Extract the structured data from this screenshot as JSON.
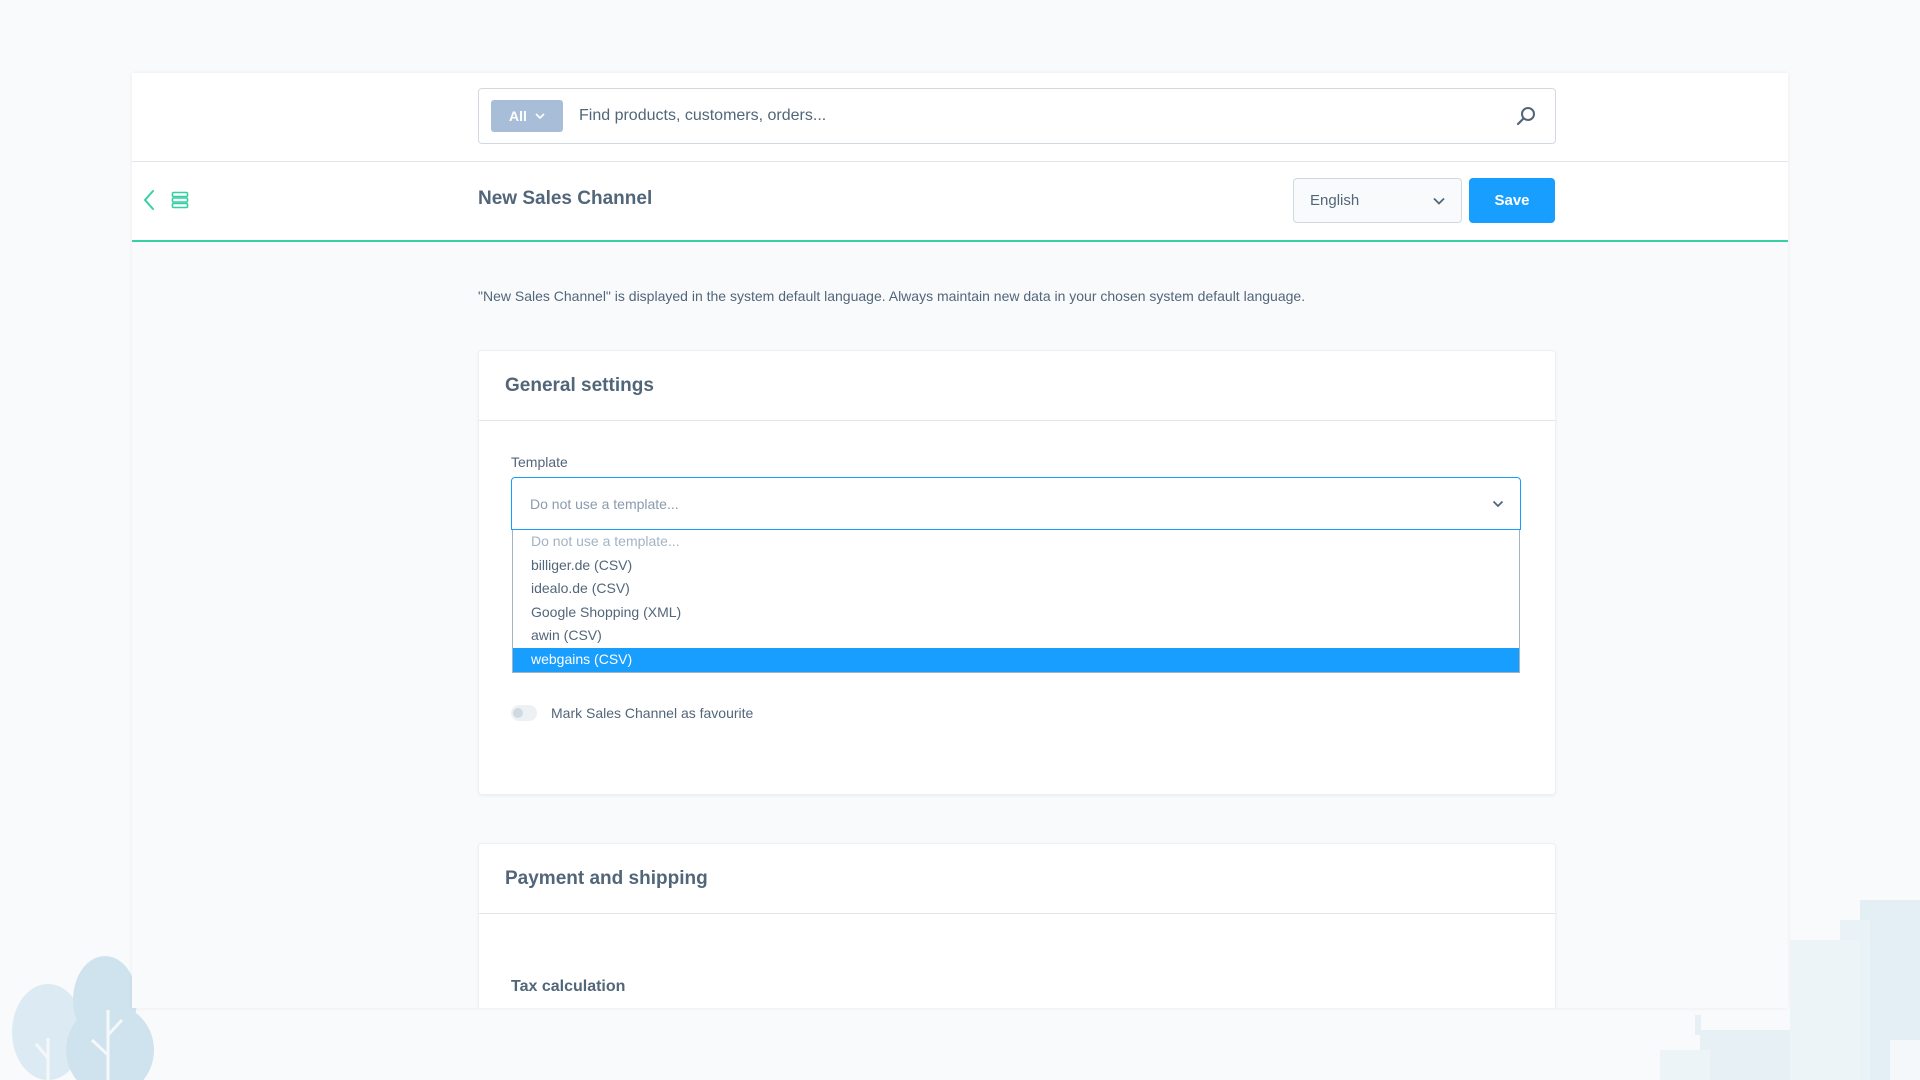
{
  "search": {
    "type_label": "All",
    "placeholder": "Find products, customers, orders..."
  },
  "smartbar": {
    "title": "New Sales Channel",
    "language": "English",
    "save_label": "Save"
  },
  "info_text": "\"New Sales Channel\" is displayed in the system default language. Always maintain new data in your chosen system default language.",
  "general_settings": {
    "title": "General settings",
    "template_label": "Template",
    "template_value": "Do not use a template...",
    "template_options": [
      "Do not use a template...",
      "billiger.de (CSV)",
      "idealo.de (CSV)",
      "Google Shopping (XML)",
      "awin (CSV)",
      "webgains (CSV)"
    ],
    "highlighted_option": "webgains (CSV)",
    "favourite_label": "Mark Sales Channel as favourite",
    "favourite_on": false
  },
  "payment_shipping": {
    "title": "Payment and shipping",
    "tax_label": "Tax calculation"
  },
  "colors": {
    "accent": "#189eff",
    "module": "#37d0a5",
    "text": "#52667a"
  }
}
